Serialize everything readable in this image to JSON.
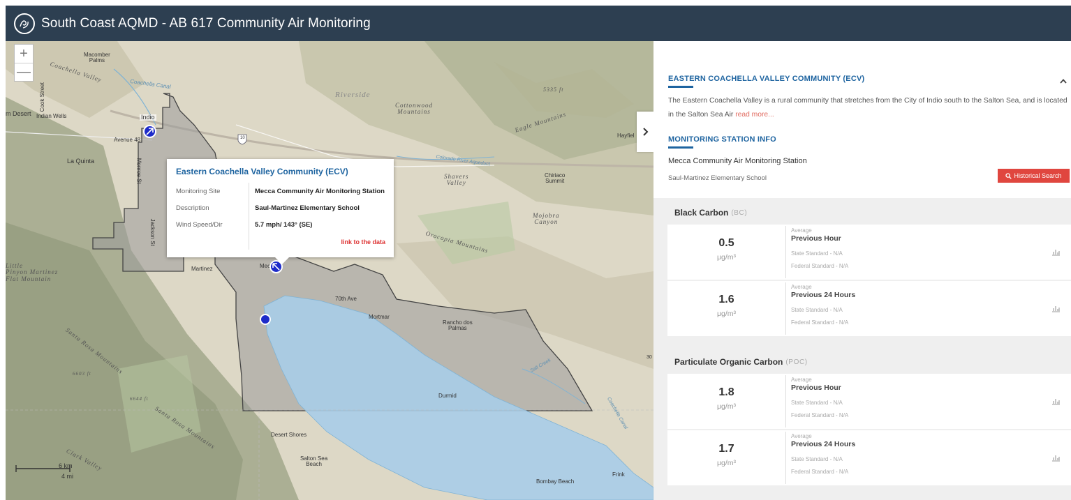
{
  "header": {
    "title": "South Coast AQMD - AB 617 Community Air Monitoring"
  },
  "map": {
    "zoom_in": "+",
    "zoom_out": "—",
    "labels": {
      "macomber_palms": "Macomber\nPalms",
      "coachella_valley": "Coachella Valley",
      "coachella_canal": "Coachella Canal",
      "cook_street": "Cook Street",
      "indio": "Indio",
      "desert": "m Desert",
      "indian_wells": "Indian Wells",
      "avenue48": "Avenue 48",
      "la_quinta": "La Quinta",
      "monroe_st": "Monroe St",
      "jackson_st": "Jackson St",
      "riverside": "Riverside",
      "cottonwood_mountains": "Cottonwood\nMountains",
      "peak_5335": "5335 ft",
      "eagle_mountains": "Eagle Mountains",
      "hayfield": "Hayfiel",
      "colorado_aqueduct": "Colorado River Aqueduct",
      "shavers_valley": "Shavers\nValley",
      "chiriaco_summit": "Chiriaco\nSummit",
      "mojave_canyon": "Mojobra\nCanyon",
      "orocopia_mountains": "Orocopia Mountains",
      "little": "Little\nPinyon Martinez\nFlat Mountain",
      "martinez": "Martinez",
      "mecca": "Mec",
      "ave70": "70th Ave",
      "mortmar": "Mortmar",
      "rancho_dos_palmas": "Rancho dos\nPalmas",
      "salt_creek": "Salt Creek",
      "santa_rosa_mountains": "Santa Rosa Mountains",
      "peak_6603": "6603 ft",
      "peak_6644": "6644 ft",
      "santa_rosa_mountains2": "Santa Rosa Mountains",
      "durmid": "Durmid",
      "coachella_canal2": "Coachella Canal",
      "desert_shores": "Desert Shores",
      "clark_valley": "Clark Valley",
      "salton_sea_beach": "Salton Sea\nBeach",
      "bombay_beach": "Bombay Beach",
      "frink": "Frink",
      "label_30": "30",
      "route_10": "10"
    },
    "scale": {
      "km": "6 km",
      "mi": "4 mi"
    }
  },
  "popup": {
    "title": "Eastern Coachella Valley Community (ECV)",
    "rows": [
      {
        "key": "Monitoring Site",
        "value": "Mecca Community Air Monitoring Station"
      },
      {
        "key": "Description",
        "value": "Saul-Martinez Elementary School"
      },
      {
        "key": "Wind Speed/Dir",
        "value": "5.7 mph/ 143° (SE)"
      }
    ],
    "link": "link to the data"
  },
  "panel": {
    "community_title": "EASTERN COACHELLA VALLEY COMMUNITY (ECV)",
    "description": "The Eastern Coachella Valley is a rural community that stretches from the City of Indio south to the Salton Sea, and is located in the Salton Sea Air",
    "read_more": "read more...",
    "station_title": "MONITORING STATION INFO",
    "station_name": "Mecca Community Air Monitoring Station",
    "station_site": "Saul-Martinez Elementary School",
    "historical_search": "Historical Search",
    "collapse_icon": "chevron-up",
    "expand_icon": "chevron-right"
  },
  "metrics": [
    {
      "name": "Black Carbon",
      "abbr": "(BC)",
      "cards": [
        {
          "value": "0.5",
          "unit": "μg/m³",
          "avg": "Average",
          "period": "Previous Hour",
          "state": "State Standard - N/A",
          "federal": "Federal Standard - N/A"
        },
        {
          "value": "1.6",
          "unit": "μg/m³",
          "avg": "Average",
          "period": "Previous 24 Hours",
          "state": "State Standard - N/A",
          "federal": "Federal Standard - N/A"
        }
      ]
    },
    {
      "name": "Particulate Organic Carbon",
      "abbr": "(POC)",
      "cards": [
        {
          "value": "1.8",
          "unit": "μg/m³",
          "avg": "Average",
          "period": "Previous Hour",
          "state": "State Standard - N/A",
          "federal": "Federal Standard - N/A"
        },
        {
          "value": "1.7",
          "unit": "μg/m³",
          "avg": "Average",
          "period": "Previous 24 Hours",
          "state": "State Standard - N/A",
          "federal": "Federal Standard - N/A"
        }
      ]
    }
  ],
  "colors": {
    "header": "#2d3f51",
    "accent": "#1e64a0",
    "button": "#e0463f",
    "marker": "#1d2bc9",
    "water": "#a8cde8",
    "community": "#9b9b9b"
  }
}
